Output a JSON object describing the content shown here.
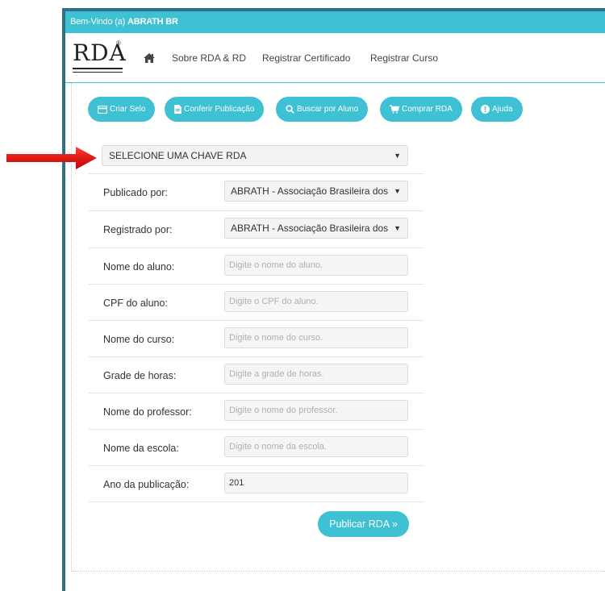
{
  "welcome": {
    "prefix": "Bem-Vindo (a)",
    "user": "ABRATH BR"
  },
  "logo": {
    "text": "RDA",
    "reg": "®"
  },
  "nav": {
    "home_icon": "home-icon",
    "links": [
      "Sobre RDA & RD",
      "Registrar Certificado",
      "Registrar Curso"
    ]
  },
  "actions": [
    {
      "label": "Criar Selo",
      "icon": "credit-card-icon"
    },
    {
      "label": "Conferir Publicação",
      "icon": "file-icon"
    },
    {
      "label": "Buscar por Aluno",
      "icon": "search-icon"
    },
    {
      "label": "Comprar RDA",
      "icon": "cart-icon"
    },
    {
      "label": "Ajuda",
      "icon": "exclamation-circle-icon"
    }
  ],
  "form": {
    "chave_select": "SELECIONE UMA CHAVE RDA",
    "publicado_label": "Publicado por:",
    "publicado_value": "ABRATH - Associação Brasileira dos",
    "registrado_label": "Registrado por:",
    "registrado_value": "ABRATH - Associação Brasileira dos",
    "aluno_label": "Nome do aluno:",
    "aluno_placeholder": "Digite o nome do aluno.",
    "cpf_label": "CPF do aluno:",
    "cpf_placeholder": "Digite o CPF do aluno.",
    "curso_label": "Nome do curso:",
    "curso_placeholder": "Digite o nome do curso.",
    "horas_label": "Grade de horas:",
    "horas_placeholder": "Digite a grade de horas.",
    "professor_label": "Nome do professor:",
    "professor_placeholder": "Digite o nome do professor.",
    "escola_label": "Nome da escola:",
    "escola_placeholder": "Digite o nome da escola.",
    "ano_label": "Ano da publicação:",
    "ano_value": "201",
    "submit_label": "Publicar RDA »"
  },
  "colors": {
    "accent": "#3ec1d3",
    "frame": "#2f6f88",
    "arrow": "#e01010"
  }
}
